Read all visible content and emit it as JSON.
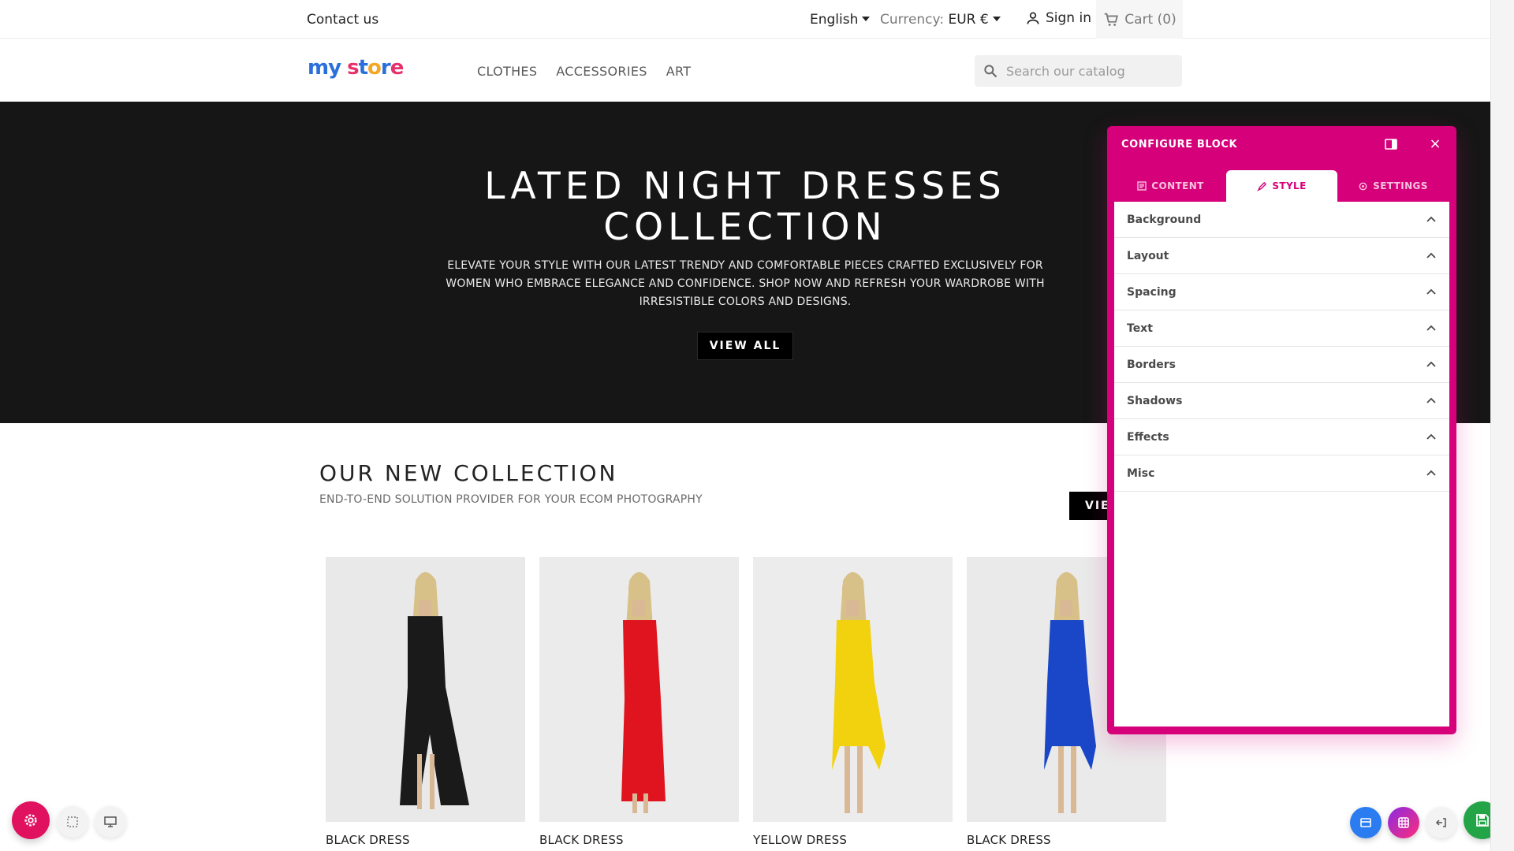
{
  "topbar": {
    "contact": "Contact us",
    "language": "English",
    "currency_label": "Currency:",
    "currency_value": "EUR €",
    "signin": "Sign in",
    "cart": "Cart (0)"
  },
  "header": {
    "logo_my": "my",
    "logo_store": "store",
    "nav": [
      "CLOTHES",
      "ACCESSORIES",
      "ART"
    ],
    "search_placeholder": "Search our catalog"
  },
  "hero": {
    "title_line1": "LATED NIGHT DRESSES",
    "title_line2": "COLLECTION",
    "description": "ELEVATE YOUR STYLE WITH OUR LATEST TRENDY AND COMFORTABLE PIECES CRAFTED EXCLUSIVELY FOR WOMEN WHO EMBRACE ELEGANCE AND CONFIDENCE. SHOP NOW AND REFRESH YOUR WARDROBE WITH IRRESISTIBLE COLORS AND DESIGNS.",
    "button": "VIEW ALL"
  },
  "collection": {
    "title": "OUR NEW COLLECTION",
    "subtitle": "END-TO-END SOLUTION PROVIDER FOR YOUR ECOM PHOTOGRAPHY",
    "view_button": "VIE",
    "products": [
      {
        "name": "BLACK DRESS",
        "color": "#1a1a1a"
      },
      {
        "name": "BLACK DRESS",
        "color": "#e0141e"
      },
      {
        "name": "YELLOW DRESS",
        "color": "#f2d10f"
      },
      {
        "name": "BLACK DRESS",
        "color": "#1a47c8"
      }
    ]
  },
  "panel": {
    "title": "CONFIGURE BLOCK",
    "tabs": [
      "CONTENT",
      "STYLE",
      "SETTINGS"
    ],
    "active_tab": "STYLE",
    "sections": [
      "Background",
      "Layout",
      "Spacing",
      "Text",
      "Borders",
      "Shadows",
      "Effects",
      "Misc"
    ],
    "accent": "#d6007a"
  }
}
